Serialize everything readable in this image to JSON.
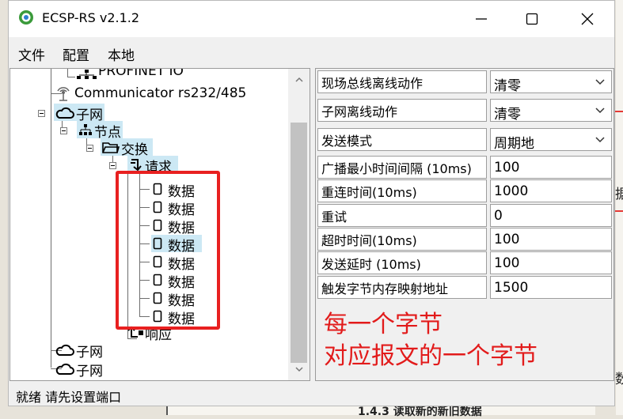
{
  "window": {
    "title": "ECSP-RS v2.1.2"
  },
  "menu": {
    "items": [
      "文件",
      "配置",
      "本地"
    ]
  },
  "tree": {
    "profinet": "PROFINET IO",
    "communicator": "Communicator rs232/485",
    "subnet": "子网",
    "node": "节点",
    "exchange": "交换",
    "request": "请求",
    "data_items": [
      "数据",
      "数据",
      "数据",
      "数据",
      "数据",
      "数据",
      "数据",
      "数据"
    ],
    "response": "响应",
    "subnet2": "子网",
    "subnet3": "子网"
  },
  "properties": [
    {
      "label": "现场总线离线动作",
      "value": "清零",
      "dropdown": true
    },
    {
      "label": "子网离线动作",
      "value": "清零",
      "dropdown": true
    },
    {
      "label": "发送模式",
      "value": "周期地",
      "dropdown": true
    },
    {
      "label": "广播最小时间间隔 (10ms)",
      "value": "100",
      "dropdown": false
    },
    {
      "label": "重连时间(10ms)",
      "value": "1000",
      "dropdown": false
    },
    {
      "label": "重试",
      "value": "0",
      "dropdown": false
    },
    {
      "label": "超时时间(10ms)",
      "value": "100",
      "dropdown": false
    },
    {
      "label": "发送延时 (10ms)",
      "value": "100",
      "dropdown": false
    },
    {
      "label": "触发字节内存映射地址",
      "value": "1500",
      "dropdown": false
    }
  ],
  "annotation": {
    "line1": "每一个字节",
    "line2": "对应报文的一个字节"
  },
  "status": {
    "text": "就绪  请先设置端口"
  },
  "background": {
    "glyph1": "据",
    "glyph2": "数",
    "heading": "1.4.3 读取新的新旧数据"
  },
  "colors": {
    "highlight": "#cce8f4",
    "annotation_red": "#e21b1b",
    "icon_blue": "#1a57a8"
  }
}
